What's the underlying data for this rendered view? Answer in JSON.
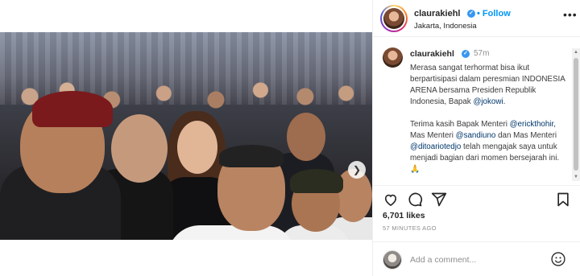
{
  "post": {
    "username": "claurakiehl",
    "follow_label": "Follow",
    "dot": "•",
    "location": "Jakarta, Indonesia",
    "more_icon": "more-horizontal-icon"
  },
  "caption": {
    "username": "claurakiehl",
    "time": "57m",
    "p1_a": "Merasa sangat terhormat bisa ikut berpartisipasi dalam peresmian INDONESIA ARENA bersama Presiden Republik Indonesia, Bapak ",
    "p1_mention": "@jokowi",
    "p1_end": ".",
    "p2_a": "Terima kasih Bapak Menteri ",
    "p2_m1": "@erickthohir",
    "p2_b": ", Mas Menteri ",
    "p2_m2": "@sandiuno",
    "p2_c": " dan Mas Menteri ",
    "p2_m3": "@ditoariotedjo",
    "p2_d": " telah mengajak saya untuk menjadi bagian dari momen bersejarah ini. 🙏"
  },
  "stats": {
    "likes": "6,701 likes",
    "time_ago": "57 MINUTES AGO"
  },
  "comment": {
    "placeholder": "Add a comment..."
  },
  "carousel": {
    "slide_count": 4,
    "active_slide": 1
  },
  "colors": {
    "accent": "#0095f6",
    "verified": "#3897f0",
    "mention": "#00376b"
  }
}
